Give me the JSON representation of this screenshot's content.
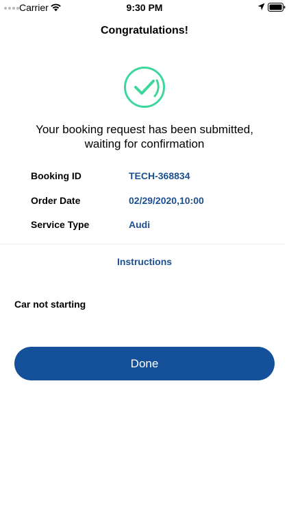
{
  "status_bar": {
    "carrier": "Carrier",
    "time": "9:30 PM",
    "icons": [
      "signal-dots-icon",
      "wifi-icon",
      "location-arrow-icon",
      "battery-icon"
    ]
  },
  "header": {
    "title": "Congratulations!"
  },
  "success_icon": {
    "name": "check-circle-icon",
    "color": "#3dd69c"
  },
  "message": {
    "line1": "Your booking request has been submitted,",
    "line2": "waiting for confirmation"
  },
  "details": [
    {
      "label": "Booking ID",
      "value": "TECH-368834"
    },
    {
      "label": "Order Date",
      "value": "02/29/2020,10:00"
    },
    {
      "label": "Service Type",
      "value": "Audi"
    }
  ],
  "instructions": {
    "heading": "Instructions",
    "text": "Car not starting"
  },
  "actions": {
    "done_label": "Done"
  },
  "colors": {
    "accent": "#15519b",
    "value_text": "#1b4f8f",
    "success": "#3dd69c"
  }
}
